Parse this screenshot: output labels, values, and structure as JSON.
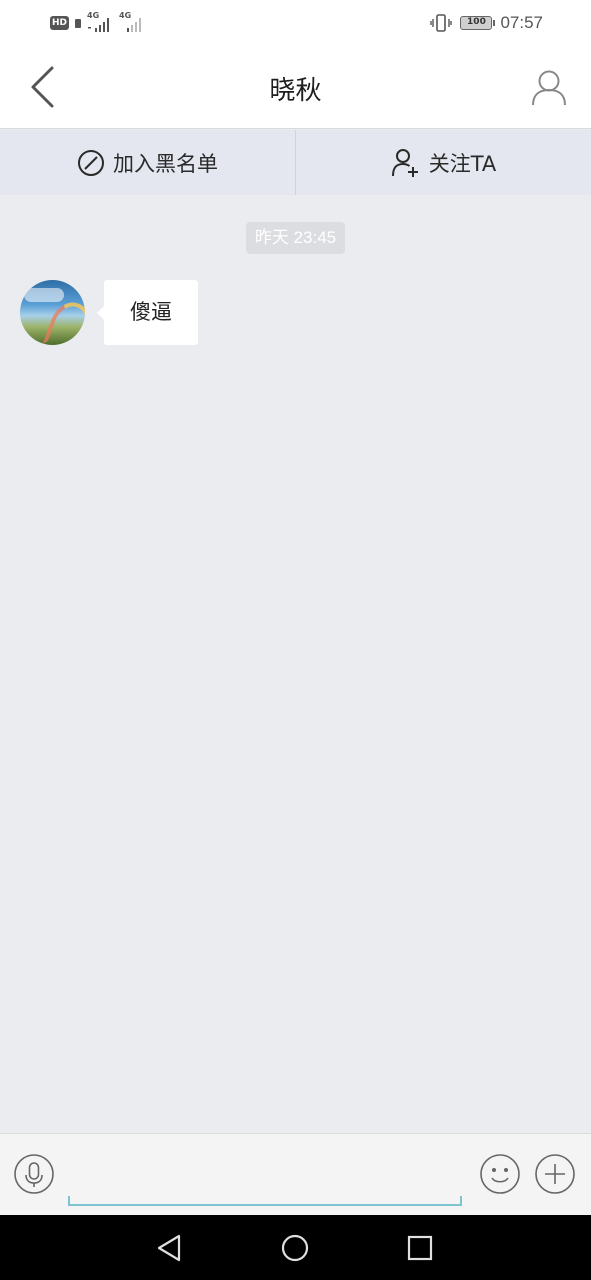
{
  "status_bar": {
    "hd_label": "HD",
    "network_1": "4G",
    "network_2": "4G",
    "battery": "100",
    "time": "07:57"
  },
  "header": {
    "title": "晓秋",
    "back_icon": "chevron-left-icon",
    "profile_icon": "user-icon"
  },
  "actions": {
    "blacklist_label": "加入黑名单",
    "blacklist_icon": "block-icon",
    "follow_label": "关注TA",
    "follow_icon": "add-user-icon"
  },
  "chat": {
    "timestamp": "昨天 23:45",
    "messages": [
      {
        "text": "傻逼",
        "sender_avatar": "landscape-rainbow-photo"
      }
    ]
  },
  "input_bar": {
    "value": "",
    "placeholder": "",
    "voice_icon": "microphone-icon",
    "emoji_icon": "smiley-icon",
    "more_icon": "plus-circle-icon"
  },
  "nav_bar": {
    "back_icon": "triangle-back-icon",
    "home_icon": "circle-home-icon",
    "recents_icon": "square-recents-icon"
  },
  "colors": {
    "chat_background": "#ebecf0",
    "action_bar": "#e4e7f0",
    "input_underline": "#7ec3d0"
  }
}
